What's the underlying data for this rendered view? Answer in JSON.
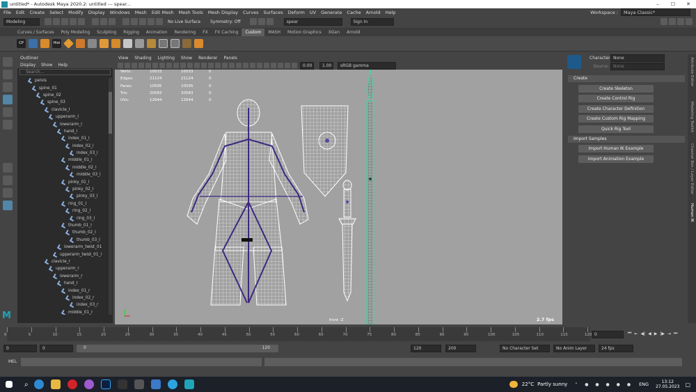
{
  "window": {
    "title": "untitled* - Autodesk Maya 2020.2: untitled   ---   spear...",
    "controls": [
      "–",
      "☐",
      "✕"
    ]
  },
  "menubar": [
    "File",
    "Edit",
    "Create",
    "Select",
    "Modify",
    "Display",
    "Windows",
    "Mesh",
    "Edit Mesh",
    "Mesh Tools",
    "Mesh Display",
    "Curves",
    "Surfaces",
    "Deform",
    "UV",
    "Generate",
    "Cache",
    "Arnold",
    "Help"
  ],
  "workspace": {
    "label": "Workspace :",
    "value": "Maya Classic*"
  },
  "status_line": {
    "mode": "Modeling",
    "live_surface": "No Live Surface",
    "symmetry": "Symmetry: Off",
    "search": "spear",
    "sign_in": "Sign In"
  },
  "shelf_tabs": [
    "Curves / Surfaces",
    "Poly Modeling",
    "Sculpting",
    "Rigging",
    "Animation",
    "Rendering",
    "FX",
    "FX Caching",
    "Custom",
    "MASH",
    "Motion Graphics",
    "XGen",
    "Arnold"
  ],
  "shelf_active": "Custom",
  "shelf_labels": {
    "cp": "CP",
    "hist": "Hist"
  },
  "outliner": {
    "title": "Outliner",
    "menu": [
      "Display",
      "Show",
      "Help"
    ],
    "search_placeholder": "Search...",
    "items": [
      {
        "name": "pelvis",
        "depth": 0
      },
      {
        "name": "spine_01",
        "depth": 1
      },
      {
        "name": "spine_02",
        "depth": 2
      },
      {
        "name": "spine_03",
        "depth": 3
      },
      {
        "name": "clavicle_l",
        "depth": 4
      },
      {
        "name": "upperarm_l",
        "depth": 5
      },
      {
        "name": "lowerarm_l",
        "depth": 6
      },
      {
        "name": "hand_l",
        "depth": 7
      },
      {
        "name": "index_01_l",
        "depth": 8
      },
      {
        "name": "index_02_l",
        "depth": 9
      },
      {
        "name": "index_03_l",
        "depth": 10
      },
      {
        "name": "middle_01_l",
        "depth": 8
      },
      {
        "name": "middle_02_l",
        "depth": 9
      },
      {
        "name": "middle_03_l",
        "depth": 10
      },
      {
        "name": "pinky_01_l",
        "depth": 8
      },
      {
        "name": "pinky_02_l",
        "depth": 9
      },
      {
        "name": "pinky_03_l",
        "depth": 10
      },
      {
        "name": "ring_01_l",
        "depth": 8
      },
      {
        "name": "ring_02_l",
        "depth": 9
      },
      {
        "name": "ring_03_l",
        "depth": 10
      },
      {
        "name": "thumb_01_l",
        "depth": 8
      },
      {
        "name": "thumb_02_l",
        "depth": 9
      },
      {
        "name": "thumb_03_l",
        "depth": 10
      },
      {
        "name": "lowerarm_twist_01",
        "depth": 7
      },
      {
        "name": "upperarm_twist_01_l",
        "depth": 6
      },
      {
        "name": "clavicle_r",
        "depth": 4
      },
      {
        "name": "upperarm_r",
        "depth": 5
      },
      {
        "name": "lowerarm_r",
        "depth": 6
      },
      {
        "name": "hand_r",
        "depth": 7
      },
      {
        "name": "index_01_r",
        "depth": 8
      },
      {
        "name": "index_02_r",
        "depth": 9
      },
      {
        "name": "index_03_r",
        "depth": 10
      },
      {
        "name": "middle_01_r",
        "depth": 8
      }
    ]
  },
  "viewport": {
    "menu": [
      "View",
      "Shading",
      "Lighting",
      "Show",
      "Renderer",
      "Panels"
    ],
    "near": "0.00",
    "far": "1.00",
    "color_space": "sRGB gamma",
    "hud": [
      {
        "label": "Verts:",
        "a": "10533",
        "b": "10533",
        "c": "0"
      },
      {
        "label": "Edges:",
        "a": "21124",
        "b": "21124",
        "c": "0"
      },
      {
        "label": "Faces:",
        "a": "10595",
        "b": "10595",
        "c": "0"
      },
      {
        "label": "Tris:",
        "a": "20583",
        "b": "20583",
        "c": "0"
      },
      {
        "label": "UVs:",
        "a": "12644",
        "b": "12644",
        "c": "0"
      }
    ],
    "camera": "front -Z",
    "fps": "2.7 fps"
  },
  "humanik": {
    "character_label": "Character:",
    "character_value": "None",
    "source_label": "Source:",
    "source_value": "None",
    "create_header": "Create",
    "create_buttons": [
      "Create Skeleton",
      "Create Control Rig",
      "Create Character Definition",
      "Create Custom Rig Mapping",
      "Quick Rig Tool"
    ],
    "import_header": "Import Samples",
    "import_buttons": [
      "Import Human IK Example",
      "Import Animation Example"
    ]
  },
  "side_tabs": [
    "Attribute Editor",
    "Modeling Toolkit",
    "Channel Box / Layer Editor",
    "Human IK"
  ],
  "timeline": {
    "ticks": [
      "0",
      "5",
      "10",
      "15",
      "20",
      "25",
      "30",
      "35",
      "40",
      "45",
      "50",
      "55",
      "60",
      "65",
      "70",
      "75",
      "80",
      "85",
      "90",
      "95",
      "100",
      "105",
      "110",
      "115",
      "120"
    ],
    "current": "0"
  },
  "range": {
    "start": "0",
    "start2": "0",
    "slider_start": "0",
    "slider_end": "120",
    "end": "120",
    "end2": "200",
    "character_set": "No Character Set",
    "anim_layer": "No Anim Layer",
    "fps": "24 fps"
  },
  "mel": {
    "label": "MEL"
  },
  "taskbar": {
    "weather_temp": "22°C",
    "weather_desc": "Partly sunny",
    "lang": "ENG",
    "time": "13:12",
    "date": "27.05.2023"
  }
}
